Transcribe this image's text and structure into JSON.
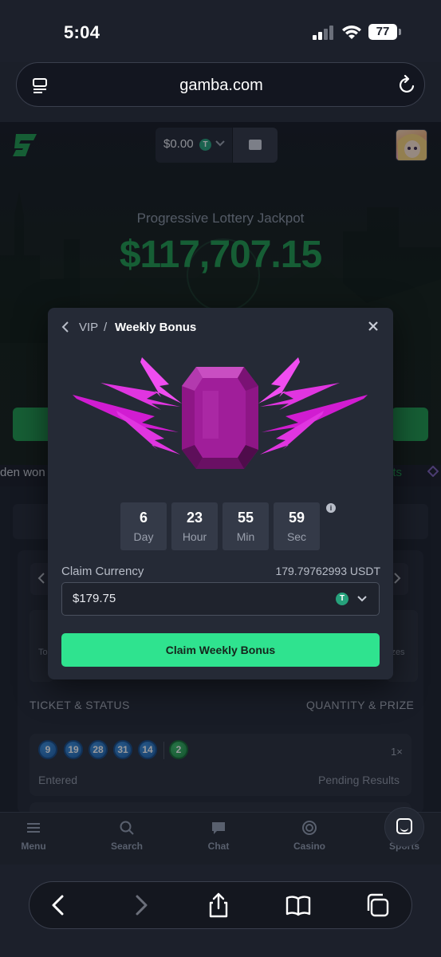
{
  "status_bar": {
    "time": "5:04",
    "battery": "77"
  },
  "browser": {
    "url": "gamba.com"
  },
  "header": {
    "balance": "$0.00",
    "currency_glyph": "T"
  },
  "hero": {
    "jackpot_label": "Progressive Lottery Jackpot",
    "jackpot_amount": "$117,707.15"
  },
  "ticker": {
    "left_text": "den  won",
    "right_text": "ets"
  },
  "table": {
    "col_ticket": "TICKET & STATUS",
    "col_prize": "QUANTITY & PRIZE",
    "prize_left_text": "To",
    "prize_right_text": "izes",
    "ticket": {
      "numbers": [
        "9",
        "19",
        "28",
        "31",
        "14"
      ],
      "bonus": "2",
      "quantity": "1×",
      "status_left": "Entered",
      "status_right": "Pending Results"
    }
  },
  "modal": {
    "breadcrumb_parent": "VIP",
    "breadcrumb_sep": "/",
    "title": "Weekly Bonus",
    "countdown": [
      {
        "value": "6",
        "label": "Day"
      },
      {
        "value": "23",
        "label": "Hour"
      },
      {
        "value": "55",
        "label": "Min"
      },
      {
        "value": "59",
        "label": "Sec"
      }
    ],
    "claim_currency_label": "Claim Currency",
    "claim_currency_amount": "179.79762993 USDT",
    "selected_value": "$179.75",
    "coin_glyph": "T",
    "claim_button": "Claim Weekly Bonus"
  },
  "bottom_nav": [
    "Menu",
    "Search",
    "Chat",
    "Casino",
    "Sports"
  ],
  "colors": {
    "accent_green": "#2fe38f",
    "jackpot_green": "#1f9a4e",
    "gem_magenta": "#d11cd1",
    "usdt": "#26a17b"
  }
}
